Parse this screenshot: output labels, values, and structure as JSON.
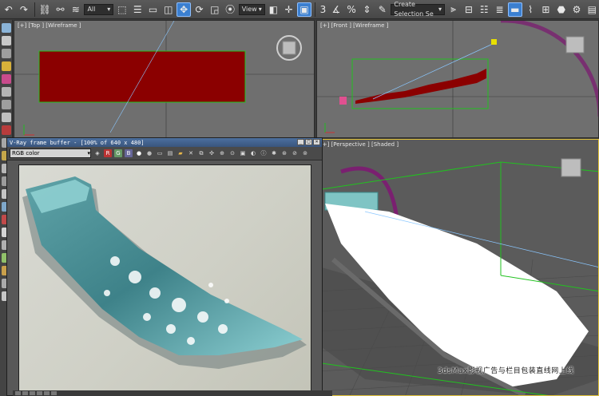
{
  "toolbar": {
    "selection_filter": "All",
    "reference_coordinate": "View",
    "angle_snap_value": "3",
    "percent_snap_label": "%",
    "create_selection_set": "Create Selection Se"
  },
  "viewports": {
    "top": {
      "label": "[+] [Top ] [Wireframe ]"
    },
    "front": {
      "label": "[+] [Front ] [Wireframe ]"
    },
    "perspective": {
      "label": "[+] [Perspective ] [Shaded ]"
    }
  },
  "frame_buffer": {
    "title": "V-Ray frame buffer - [100% of 640 x 480]",
    "channel": "RGB color",
    "channel_buttons": [
      "R",
      "G",
      "B"
    ]
  },
  "watermark": "3dsMax影视广告与栏目包装直线网上线",
  "colors": {
    "accent_active": "#3b7fd0",
    "viewport_bg": "#6f6f6f",
    "wire_red": "#8b0000",
    "selection_green": "#21c21f",
    "magenta_path": "#7a2070"
  }
}
